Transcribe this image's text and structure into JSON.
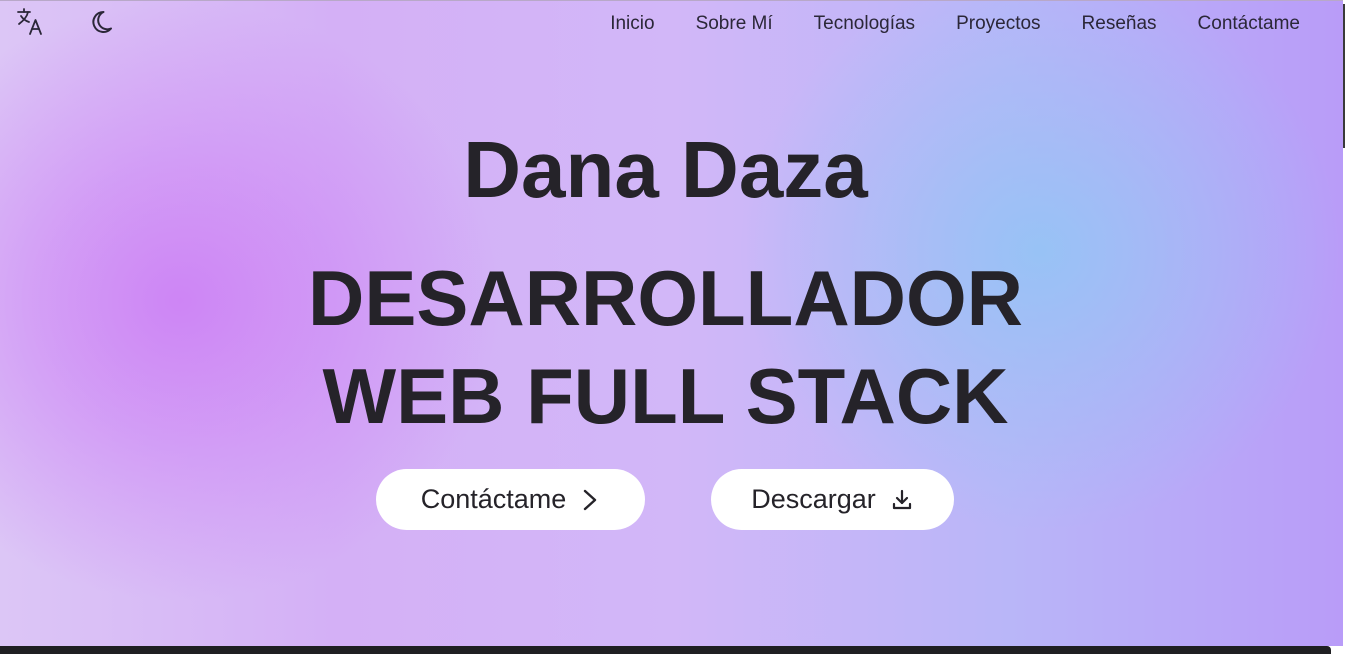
{
  "nav": {
    "links": [
      "Inicio",
      "Sobre Mí",
      "Tecnologías",
      "Proyectos",
      "Reseñas",
      "Contáctame"
    ]
  },
  "toolbar": {
    "icons": [
      "translate-icon",
      "moon-icon"
    ]
  },
  "hero": {
    "name": "Dana Daza",
    "role_line1": "DESARROLLADOR",
    "role_line2": "WEB FULL STACK",
    "contact_button": "Contáctame",
    "download_button": "Descargar"
  },
  "colors": {
    "text": "#252329",
    "gradient_pink": "#cd82f5",
    "gradient_blue": "#96c3f5",
    "gradient_violet": "#b99cf8",
    "button_bg": "#ffffff",
    "bottom_bar": "#1f1f22"
  }
}
